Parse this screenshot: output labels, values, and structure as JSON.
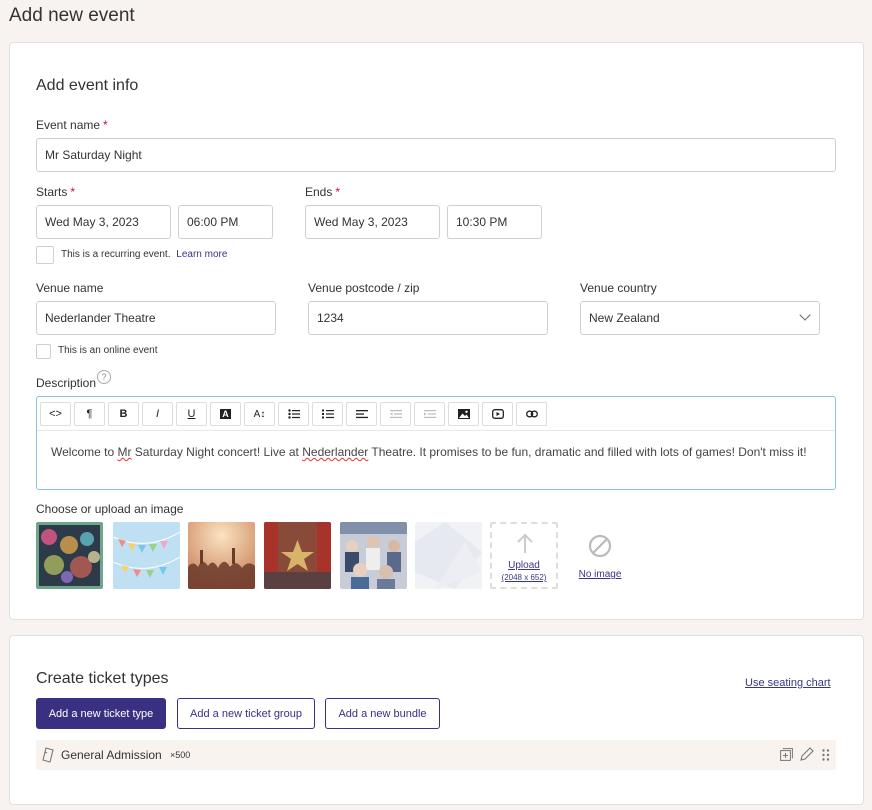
{
  "page": {
    "title": "Add new event"
  },
  "event_info": {
    "title": "Add event info",
    "event_name": {
      "label": "Event name",
      "required": "*",
      "value": "Mr Saturday Night"
    },
    "starts": {
      "label": "Starts",
      "required": "*",
      "date": "Wed May 3, 2023",
      "time": "06:00 PM"
    },
    "ends": {
      "label": "Ends",
      "required": "*",
      "date": "Wed May 3, 2023",
      "time": "10:30 PM"
    },
    "recurring": {
      "text": "This is a recurring event.",
      "link": "Learn more"
    },
    "venue_name": {
      "label": "Venue name",
      "value": "Nederlander Theatre"
    },
    "venue_postcode": {
      "label": "Venue postcode / zip",
      "value": "1234"
    },
    "venue_country": {
      "label": "Venue country",
      "value": "New Zealand"
    },
    "online": {
      "text": "This is an online event"
    },
    "description": {
      "label": "Description",
      "help": "?",
      "toolbar": [
        "<>",
        "¶",
        "B",
        "I",
        "U",
        "A",
        "A↕",
        "bulleted-list-icon",
        "numbered-list-icon",
        "align-icon",
        "outdent-icon",
        "indent-icon",
        "image-icon",
        "video-icon",
        "link-icon"
      ],
      "text_parts": [
        "Welcome to ",
        "Mr",
        " Saturday Night concert! Live at ",
        "Nederlander",
        " Theatre. It promises to be fun, dramatic and filled with lots of games! Don't miss it!"
      ]
    },
    "image": {
      "label": "Choose or upload an image",
      "upload": {
        "label": "Upload",
        "size": "(2048 x 652)"
      },
      "no_image": "No image"
    }
  },
  "tickets": {
    "title": "Create ticket types",
    "seating_link": "Use seating chart",
    "buttons": {
      "add_type": "Add a new ticket type",
      "add_group": "Add a new ticket group",
      "add_bundle": "Add a new bundle"
    },
    "rows": [
      {
        "name": "General Admission",
        "qty": "×500"
      }
    ]
  },
  "colors": {
    "primary": "#3a3082",
    "required": "#c8102e",
    "editor_border": "#86c5d8",
    "selected_image": "#6fa58a"
  }
}
